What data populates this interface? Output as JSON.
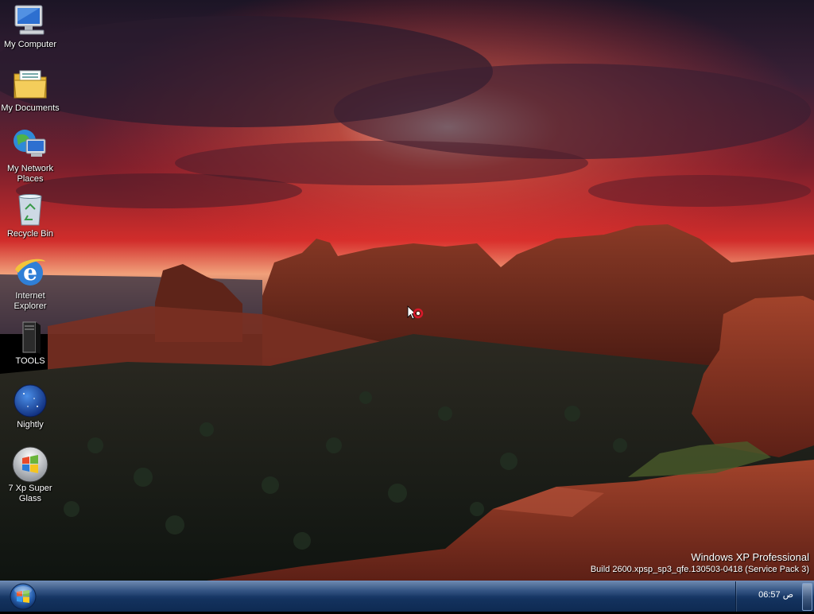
{
  "desktop": {
    "icons": [
      {
        "label": "My Computer",
        "icon": "my-computer-icon"
      },
      {
        "label": "My Documents",
        "icon": "my-documents-icon"
      },
      {
        "label": "My Network\nPlaces",
        "icon": "my-network-places-icon"
      },
      {
        "label": "Recycle Bin",
        "icon": "recycle-bin-icon"
      },
      {
        "label": "Internet\nExplorer",
        "icon": "internet-explorer-icon"
      },
      {
        "label": "TOOLS",
        "icon": "tools-icon"
      },
      {
        "label": "Nightly",
        "icon": "nightly-icon"
      },
      {
        "label": "7 Xp Super\nGlass",
        "icon": "windows-logo-icon"
      }
    ]
  },
  "watermark": {
    "line1": "Windows XP Professional",
    "line2": "Build 2600.xpsp_sp3_qfe.130503-0418 (Service Pack 3)"
  },
  "taskbar": {
    "start_icon": "windows-start-orb-icon",
    "clock": "06:57 ص"
  },
  "colors": {
    "taskbar": "#1b3d6d",
    "sky_red": "#c4202a",
    "rock": "#7a2a1e"
  }
}
